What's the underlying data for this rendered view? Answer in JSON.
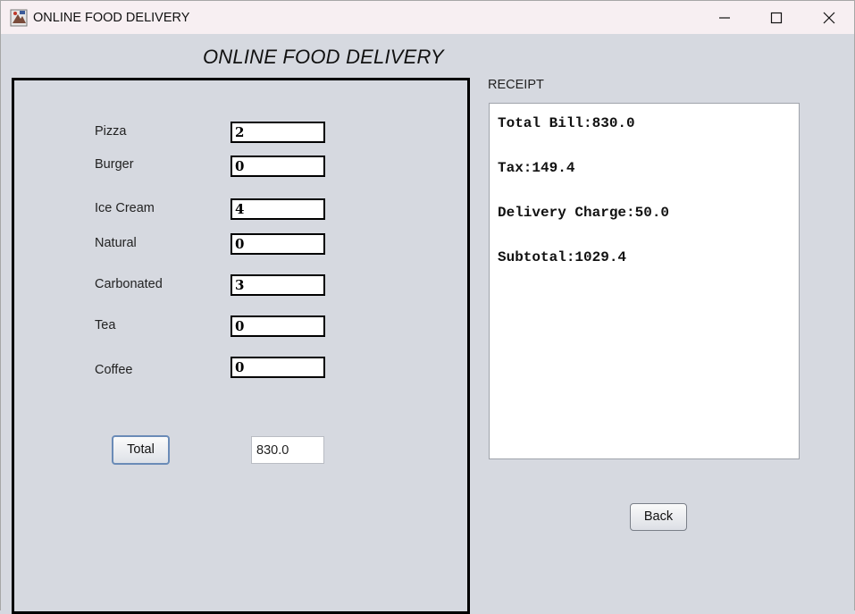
{
  "window": {
    "title": "ONLINE FOOD DELIVERY",
    "icon": "java-app-icon",
    "controls": [
      "minimize-icon",
      "maximize-icon",
      "close-icon"
    ]
  },
  "heading": "ONLINE FOOD DELIVERY",
  "order": {
    "items": [
      {
        "label": "Pizza",
        "quantity": "2"
      },
      {
        "label": "Burger",
        "quantity": "0"
      },
      {
        "label": "Ice Cream",
        "quantity": "4"
      },
      {
        "label": "Natural",
        "quantity": "0"
      },
      {
        "label": "Carbonated",
        "quantity": "3"
      },
      {
        "label": "Tea",
        "quantity": "0"
      },
      {
        "label": "Coffee",
        "quantity": "0"
      }
    ],
    "total_button_label": "Total",
    "total_value": "830.0"
  },
  "receipt": {
    "label": "RECEIPT",
    "lines": [
      "Total Bill:830.0",
      "Tax:149.4",
      "Delivery Charge:50.0",
      "Subtotal:1029.4"
    ]
  },
  "back_button_label": "Back",
  "colors": {
    "background": "#d6d9e0",
    "titlebar": "#f7eff2",
    "button_border_focus": "#6a8bb7"
  }
}
